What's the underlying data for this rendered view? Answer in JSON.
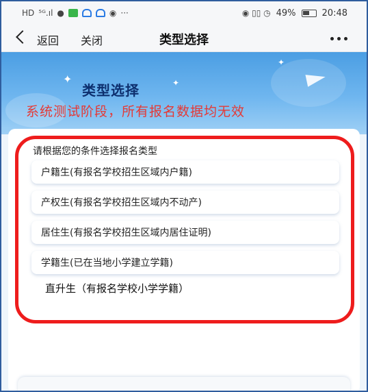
{
  "status_bar": {
    "hd": "HD",
    "signal": "⁵ᴳ.ıl",
    "dots": "···",
    "right_icons": "◉ ▯▯ ◷",
    "battery_percent": "49%",
    "time": "20:48"
  },
  "nav": {
    "back_label": "返回",
    "close_label": "关闭",
    "title": "类型选择"
  },
  "banner": {
    "title": "类型选择",
    "warning": "系统测试阶段，所有报名数据均无效"
  },
  "form": {
    "heading": "请根据您的条件选择报名类型",
    "options": [
      "户籍生(有报名学校招生区域内户籍)",
      "产权生(有报名学校招生区域内不动产)",
      "居住生(有报名学校招生区域内居住证明)",
      "学籍生(已在当地小学建立学籍)",
      "直升生（有报名学校小学学籍）"
    ]
  },
  "colors": {
    "warning_red": "#e53935",
    "annotation_red": "#ee1c1c",
    "banner_blue": "#4b9ee3"
  }
}
